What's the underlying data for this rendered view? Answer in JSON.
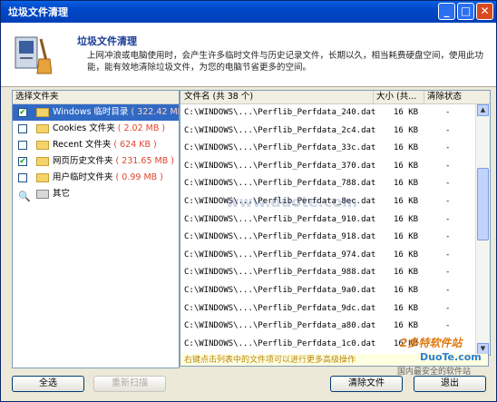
{
  "window": {
    "title": "垃圾文件清理"
  },
  "header": {
    "icon": "broom-computer-icon",
    "heading": "垃圾文件清理",
    "description": "上网冲浪或电脑使用时，会产生许多临时文件与历史记录文件，长期以久，相当耗费硬盘空间，使用此功能，能有效地清除垃圾文件，为您的电脑节省更多的空间。"
  },
  "left": {
    "header": "选择文件夹",
    "items": [
      {
        "label": "Windows 临时目录",
        "size": "( 322.42 MB )",
        "checked": true,
        "selected": true,
        "icon": "folder-icon"
      },
      {
        "label": "Cookies 文件夹",
        "size": "( 2.02 MB )",
        "checked": false,
        "selected": false,
        "icon": "folder-icon"
      },
      {
        "label": "Recent 文件夹",
        "size": "( 624 KB )",
        "checked": false,
        "selected": false,
        "icon": "folder-icon"
      },
      {
        "label": "网页历史文件夹",
        "size": "( 231.65 MB )",
        "checked": true,
        "selected": false,
        "icon": "folder-icon"
      },
      {
        "label": "用户临时文件夹",
        "size": "( 0.99 MB )",
        "checked": false,
        "selected": false,
        "icon": "folder-icon"
      },
      {
        "label": "其它",
        "size": "",
        "checked": false,
        "selected": false,
        "icon": "magnifier-icon"
      }
    ]
  },
  "right": {
    "col_name": "文件名 (共 38 个)",
    "col_size": "大小 (共...",
    "col_status": "清除状态",
    "rows": [
      {
        "name": "C:\\WINDOWS\\...\\Perflib_Perfdata_240.dat",
        "size": "16 KB",
        "status": "-"
      },
      {
        "name": "C:\\WINDOWS\\...\\Perflib_Perfdata_2c4.dat",
        "size": "16 KB",
        "status": "-"
      },
      {
        "name": "C:\\WINDOWS\\...\\Perflib_Perfdata_33c.dat",
        "size": "16 KB",
        "status": "-"
      },
      {
        "name": "C:\\WINDOWS\\...\\Perflib_Perfdata_370.dat",
        "size": "16 KB",
        "status": "-"
      },
      {
        "name": "C:\\WINDOWS\\...\\Perflib_Perfdata_788.dat",
        "size": "16 KB",
        "status": "-"
      },
      {
        "name": "C:\\WINDOWS\\...\\Perflib_Perfdata_8ec.dat",
        "size": "16 KB",
        "status": "-"
      },
      {
        "name": "C:\\WINDOWS\\...\\Perflib_Perfdata_910.dat",
        "size": "16 KB",
        "status": "-"
      },
      {
        "name": "C:\\WINDOWS\\...\\Perflib_Perfdata_918.dat",
        "size": "16 KB",
        "status": "-"
      },
      {
        "name": "C:\\WINDOWS\\...\\Perflib_Perfdata_974.dat",
        "size": "16 KB",
        "status": "-"
      },
      {
        "name": "C:\\WINDOWS\\...\\Perflib_Perfdata_988.dat",
        "size": "16 KB",
        "status": "-"
      },
      {
        "name": "C:\\WINDOWS\\...\\Perflib_Perfdata_9a0.dat",
        "size": "16 KB",
        "status": "-"
      },
      {
        "name": "C:\\WINDOWS\\...\\Perflib_Perfdata_9dc.dat",
        "size": "16 KB",
        "status": "-"
      },
      {
        "name": "C:\\WINDOWS\\...\\Perflib_Perfdata_a80.dat",
        "size": "16 KB",
        "status": "-"
      },
      {
        "name": "C:\\WINDOWS\\...\\Perflib_Perfdata_1c0.dat",
        "size": "16 KB",
        "status": "-"
      }
    ]
  },
  "status_tip": "右键点击列表中的文件项可以进行更多高级操作",
  "buttons": {
    "select_all": "全选",
    "rescan": "重新扫描",
    "clean": "清除文件",
    "exit": "退出"
  },
  "watermark": {
    "top": "www.duote.com",
    "brand": "2多特软件站",
    "site": "DuoTe.com",
    "tag": "国内最安全的软件站"
  }
}
